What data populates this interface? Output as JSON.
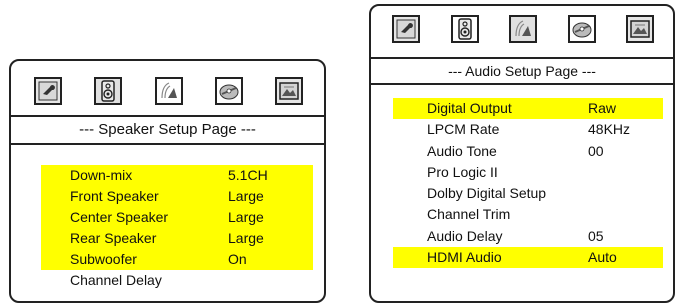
{
  "speaker_panel": {
    "title": "--- Speaker Setup Page ---",
    "tabs": [
      {
        "icon": "wrench-icon",
        "active": false
      },
      {
        "icon": "speaker-icon",
        "active": true
      },
      {
        "icon": "dolby-icon",
        "active": false
      },
      {
        "icon": "disc-icon",
        "active": false
      },
      {
        "icon": "picture-icon",
        "active": false
      }
    ],
    "items": [
      {
        "label": "Down-mix",
        "value": "5.1CH",
        "highlighted": true
      },
      {
        "label": "Front Speaker",
        "value": "Large",
        "highlighted": true
      },
      {
        "label": "Center Speaker",
        "value": "Large",
        "highlighted": true
      },
      {
        "label": "Rear Speaker",
        "value": "Large",
        "highlighted": true
      },
      {
        "label": "Subwoofer",
        "value": "On",
        "highlighted": true
      },
      {
        "label": "Channel Delay",
        "value": "",
        "highlighted": false
      }
    ]
  },
  "audio_panel": {
    "title": "--- Audio Setup Page ---",
    "tabs": [
      {
        "icon": "wrench-icon",
        "active": false
      },
      {
        "icon": "speaker-icon",
        "active": false
      },
      {
        "icon": "dolby-icon",
        "active": true
      },
      {
        "icon": "disc-icon",
        "active": false
      },
      {
        "icon": "picture-icon",
        "active": false
      }
    ],
    "items": [
      {
        "label": "Digital Output",
        "value": "Raw",
        "highlighted": true
      },
      {
        "label": "LPCM Rate",
        "value": "48KHz",
        "highlighted": false
      },
      {
        "label": "Audio Tone",
        "value": "00",
        "highlighted": false
      },
      {
        "label": "Pro Logic II",
        "value": "",
        "highlighted": false
      },
      {
        "label": "Dolby Digital Setup",
        "value": "",
        "highlighted": false
      },
      {
        "label": "Channel Trim",
        "value": "",
        "highlighted": false
      },
      {
        "label": "Audio Delay",
        "value": "05",
        "highlighted": false
      },
      {
        "label": "HDMI Audio",
        "value": "Auto",
        "highlighted": true
      }
    ]
  },
  "colors": {
    "highlight": "#ffff00",
    "border": "#222222"
  }
}
